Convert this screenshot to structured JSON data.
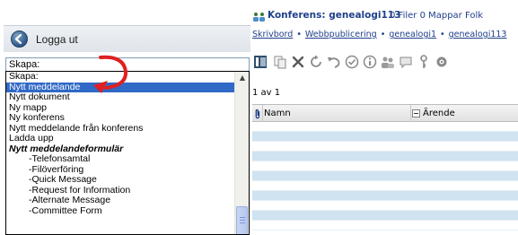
{
  "sidebar": {
    "logout_label": "Logga ut",
    "create_select": {
      "selected": "Skapa:",
      "options": [
        {
          "label": "Skapa:",
          "type": "normal"
        },
        {
          "label": "Nytt meddelande",
          "type": "selected"
        },
        {
          "label": "Nytt dokument",
          "type": "normal"
        },
        {
          "label": "Ny mapp",
          "type": "normal"
        },
        {
          "label": "Ny konferens",
          "type": "normal"
        },
        {
          "label": "Nytt meddelande från konferens",
          "type": "normal"
        },
        {
          "label": "Ladda upp",
          "type": "normal"
        },
        {
          "label": "Nytt meddelandeformulär",
          "type": "group"
        },
        {
          "label": "-Telefonsamtal",
          "type": "indent"
        },
        {
          "label": "-Filöverföring",
          "type": "indent"
        },
        {
          "label": "-Quick Message",
          "type": "indent"
        },
        {
          "label": "-Request for Information",
          "type": "indent"
        },
        {
          "label": "-Alternate Message",
          "type": "indent"
        },
        {
          "label": "-Committee Form",
          "type": "indent"
        }
      ]
    }
  },
  "conference": {
    "title": "Konferens: genealogi113",
    "stats": "0 Filer 0 Mappar   Folk"
  },
  "breadcrumb": {
    "items": [
      "Skrivbord",
      "Webbpublicering",
      "genealogi1",
      "genealogi113"
    ],
    "separator": "•"
  },
  "toolbar": {
    "icons": [
      "panel-toggle-icon",
      "copy-icon",
      "delete-icon",
      "refresh-icon",
      "undo-icon",
      "check-icon",
      "info-icon",
      "users-icon",
      "chat-icon",
      "key-icon",
      "settings-icon"
    ]
  },
  "pager": {
    "text": "1 av 1"
  },
  "grid": {
    "columns": {
      "attach_icon": "paperclip-icon",
      "name": "Namn",
      "subject": "Ärende"
    }
  },
  "colors": {
    "link": "#1f3f8a",
    "selection": "#3169c6",
    "row_alt": "#cfe3f1",
    "arrow": "#e02020"
  }
}
